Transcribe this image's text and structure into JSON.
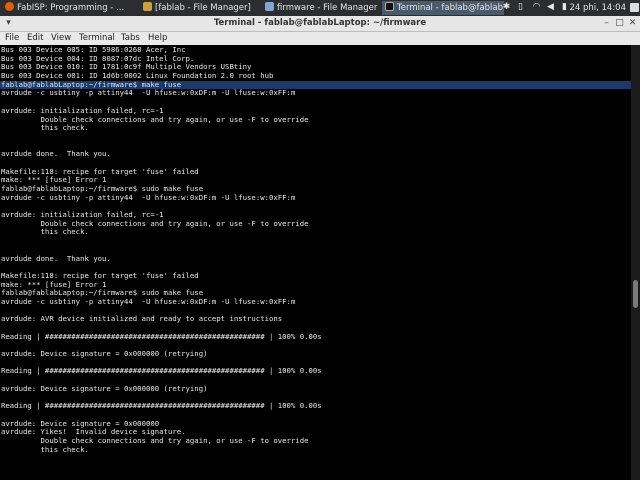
{
  "taskbar": {
    "tasks": [
      {
        "label": "FabISP: Programming - ..."
      },
      {
        "label": "[fablab - File Manager]"
      },
      {
        "label": "firmware - File Manager"
      },
      {
        "label": "Terminal - fablab@fablab..."
      }
    ],
    "clock": "24 phi, 14:04"
  },
  "window": {
    "title": "Terminal - fablab@fablabLaptop: ~/firmware",
    "menu": [
      "File",
      "Edit",
      "View",
      "Terminal",
      "Tabs",
      "Help"
    ]
  },
  "terminal": {
    "lines": [
      "Bus 003 Device 005: ID 5986:0268 Acer, Inc",
      "Bus 003 Device 004: ID 8087:07dc Intel Corp.",
      "Bus 003 Device 010: ID 1781:0c9f Multiple Vendors USBtiny",
      "Bus 003 Device 001: ID 1d6b:0002 Linux Foundation 2.0 root hub",
      "fablab@fablabLaptop:~/firmware$ make fuse",
      "avrdude -c usbtiny -p attiny44  -U hfuse:w:0xDF:m -U lfuse:w:0xFF:m",
      "",
      "avrdude: initialization failed, rc=-1",
      "         Double check connections and try again, or use -F to override",
      "         this check.",
      "",
      "",
      "avrdude done.  Thank you.",
      "",
      "Makefile:118: recipe for target 'fuse' failed",
      "make: *** [fuse] Error 1",
      "fablab@fablabLaptop:~/firmware$ sudo make fuse",
      "avrdude -c usbtiny -p attiny44  -U hfuse:w:0xDF:m -U lfuse:w:0xFF:m",
      "",
      "avrdude: initialization failed, rc=-1",
      "         Double check connections and try again, or use -F to override",
      "         this check.",
      "",
      "",
      "avrdude done.  Thank you.",
      "",
      "Makefile:118: recipe for target 'fuse' failed",
      "make: *** [fuse] Error 1",
      "fablab@fablabLaptop:~/firmware$ sudo make fuse",
      "avrdude -c usbtiny -p attiny44  -U hfuse:w:0xDF:m -U lfuse:w:0xFF:m",
      "",
      "avrdude: AVR device initialized and ready to accept instructions",
      "",
      "Reading | ################################################## | 100% 0.00s",
      "",
      "avrdude: Device signature = 0x000000 (retrying)",
      "",
      "Reading | ################################################## | 100% 0.00s",
      "",
      "avrdude: Device signature = 0x000000 (retrying)",
      "",
      "Reading | ################################################## | 100% 0.00s",
      "",
      "avrdude: Device signature = 0x000000",
      "avrdude: Yikes!  Invalid device signature.",
      "         Double check connections and try again, or use -F to override",
      "         this check."
    ],
    "highlighted_line": 4
  },
  "colors": {
    "terminal_bg": "#000000",
    "terminal_fg": "#e8e8e8",
    "highlight": "#1a3a6a",
    "panel_bg": "#2b2d30"
  }
}
